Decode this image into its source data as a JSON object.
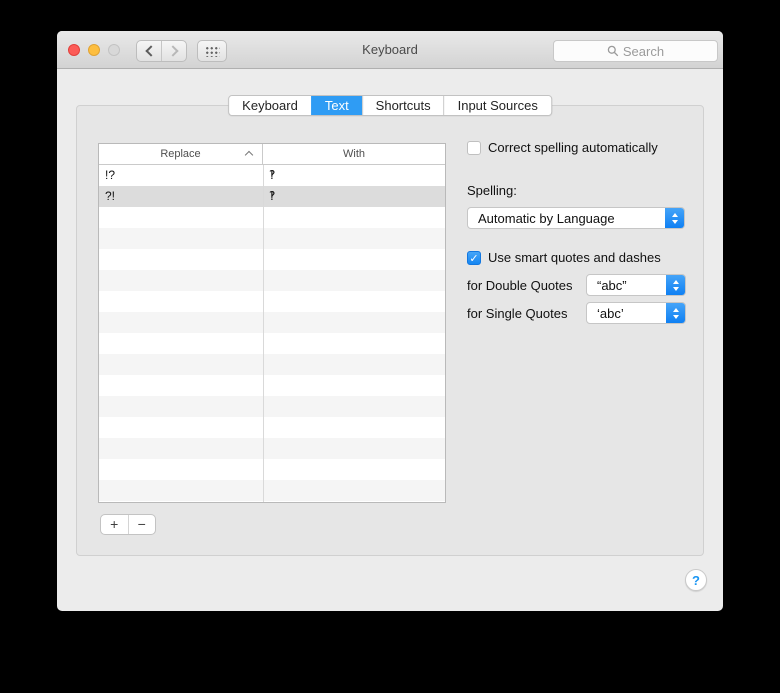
{
  "window": {
    "title": "Keyboard"
  },
  "titlebar": {
    "search_placeholder": "Search"
  },
  "tabs": [
    {
      "label": "Keyboard",
      "selected": false
    },
    {
      "label": "Text",
      "selected": true
    },
    {
      "label": "Shortcuts",
      "selected": false
    },
    {
      "label": "Input Sources",
      "selected": false
    }
  ],
  "table": {
    "columns": {
      "replace": "Replace",
      "with": "With"
    },
    "sort": "ascending-on-replace",
    "rows": [
      {
        "replace": "!?",
        "with": "‽",
        "selected": false
      },
      {
        "replace": "?!",
        "with": "‽",
        "selected": true
      }
    ]
  },
  "controls": {
    "correct_spelling": {
      "label": "Correct spelling automatically",
      "checked": false
    },
    "spelling": {
      "label": "Spelling:",
      "value": "Automatic by Language"
    },
    "smart_quotes": {
      "label": "Use smart quotes and dashes",
      "checked": true
    },
    "double_quotes": {
      "label": "for Double Quotes",
      "value": "“abc”"
    },
    "single_quotes": {
      "label": "for Single Quotes",
      "value": "‘abc’"
    }
  },
  "buttons": {
    "add": "+",
    "remove": "−",
    "help": "?",
    "check_glyph": "✓"
  },
  "colors": {
    "accent_blue": "#2f9cf4",
    "selected_row": "#dcdcdc",
    "stripe": "#f5f5f5",
    "traffic_red": "#fc5b57",
    "traffic_yellow": "#fdbe3f",
    "traffic_disabled": "#d8d8d8"
  }
}
